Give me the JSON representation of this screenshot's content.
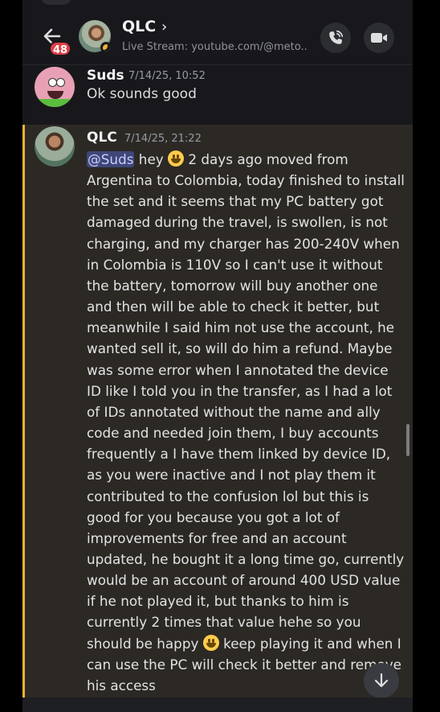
{
  "header": {
    "back_label": "back",
    "unread_badge": "48",
    "title": "QLC",
    "chevron": "›",
    "status": "Live Stream: youtube.com/@meto..."
  },
  "icons": {
    "back": "arrow-left-icon",
    "call": "phone-call-icon",
    "video": "video-camera-icon",
    "jump": "arrow-down-icon",
    "presence": "moon-idle-icon"
  },
  "colors": {
    "accent_highlight": "#f0b232",
    "badge": "#e03e45",
    "mention_bg": "#3f4779"
  },
  "messages": [
    {
      "author": "Suds",
      "timestamp": "7/14/25, 10:52",
      "content": "Ok sounds good"
    },
    {
      "author": "QLC",
      "timestamp": "7/14/25, 21:22",
      "mention": "@Suds",
      "content_part1": " hey ",
      "content_part2": " 2 days ago moved from Argentina to Colombia, today finished to install the set and it seems that my PC battery got damaged during the travel, is swollen, is not charging, and my charger has 200-240V when in Colombia is 110V so I can't use it without the battery, tomorrow will buy another one and then will be able to check it better, but meanwhile I said him not use the account, he wanted sell it, so will do him a refund. Maybe was some error when I annotated the device ID like I told you in the transfer, as I had a lot of IDs annotated without the name and ally code and needed join them, I buy accounts frequently a I have them linked by device ID, as you were inactive and I not play them it contributed to the confusion lol but this is good for you because you got a lot of improvements for free and an account updated, he bought it a long time go, currently would be an account of around 400 USD value if he not played it, but thanks to him is currently 2 times that value hehe so you should be happy ",
      "content_part3": " keep playing it and when I can use the PC will check it better and remove his access"
    }
  ]
}
